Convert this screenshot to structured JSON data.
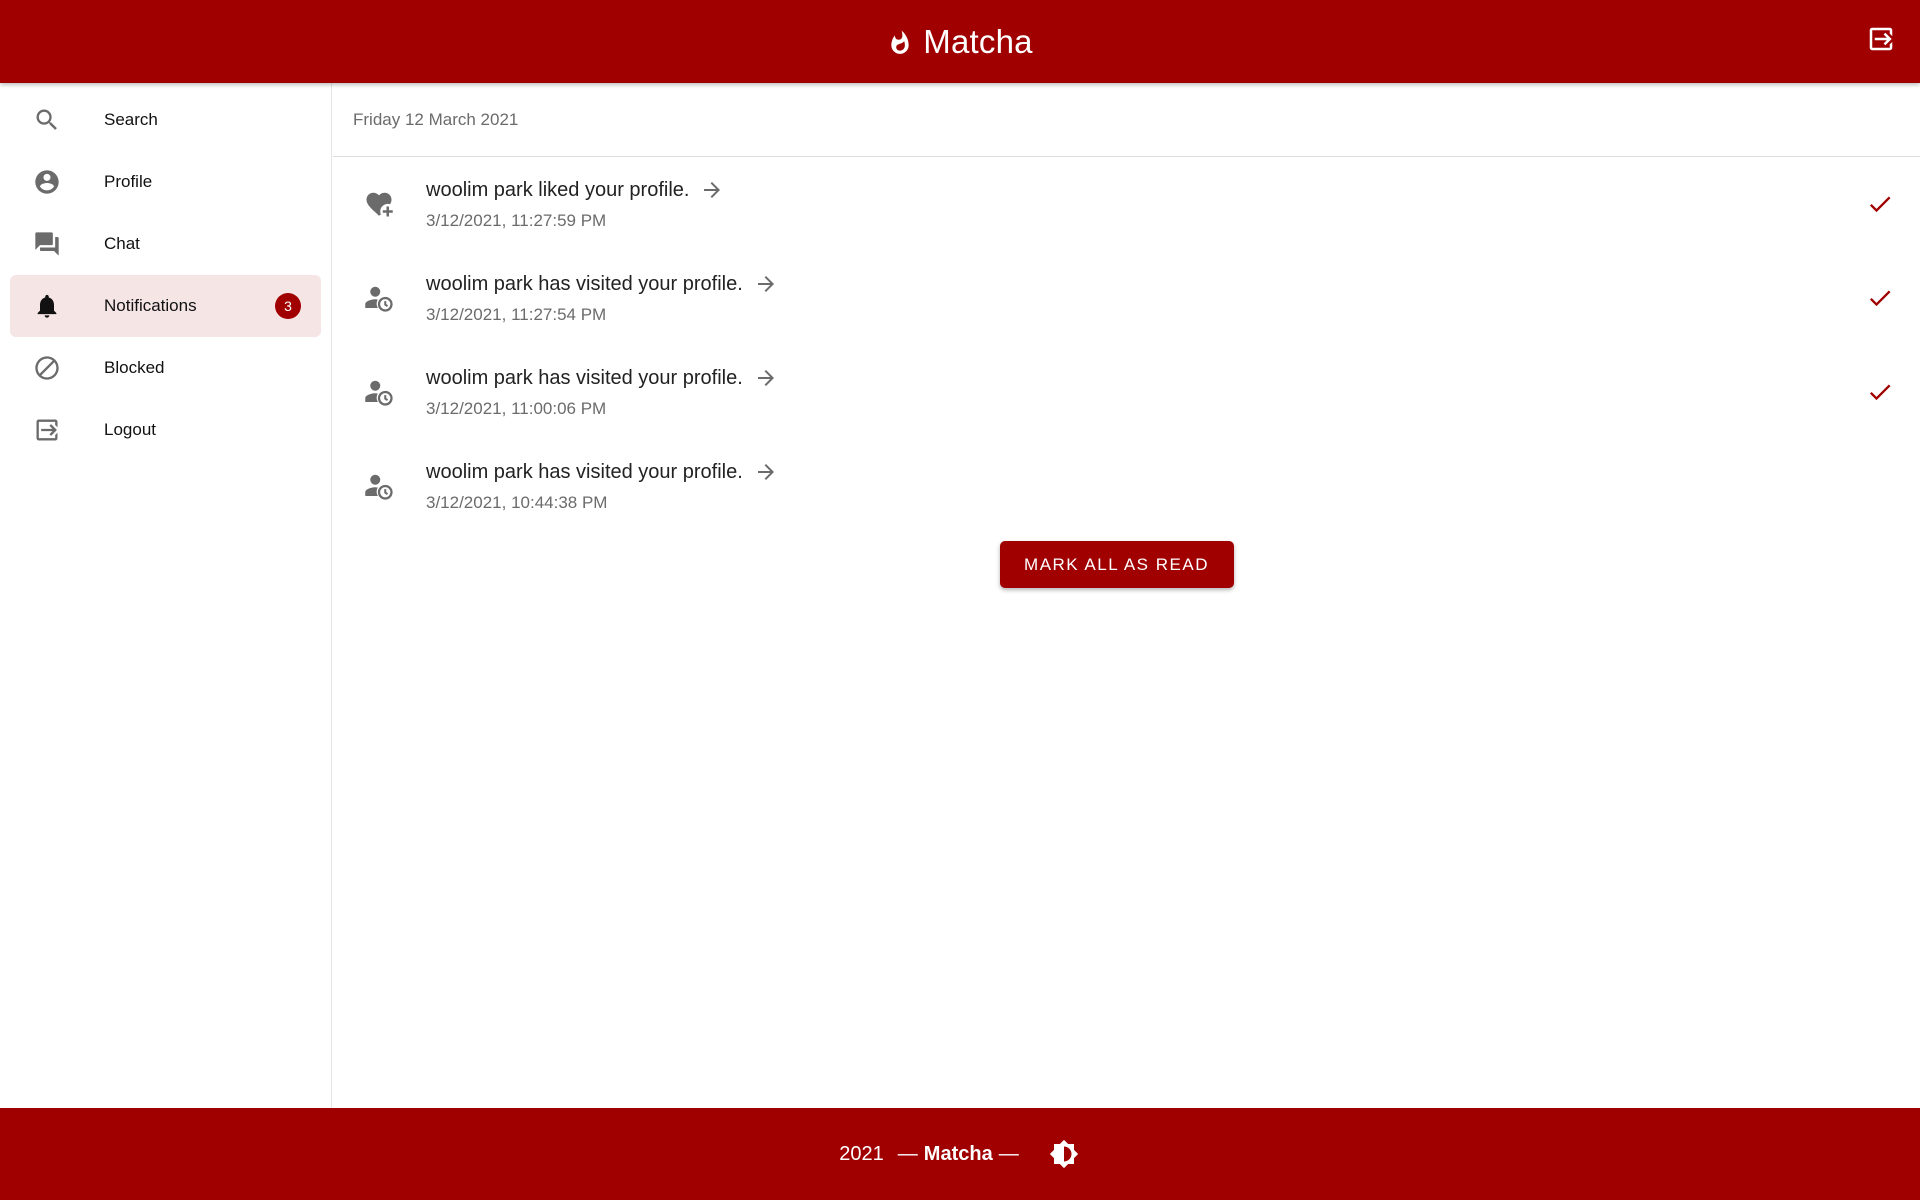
{
  "app": {
    "title": "Matcha",
    "brand_color": "#a00000"
  },
  "header": {
    "title": "Matcha",
    "icons": [
      "flame-icon",
      "logout-icon"
    ]
  },
  "sidebar": {
    "items": [
      {
        "label": "Search",
        "icon": "search-icon",
        "active": false
      },
      {
        "label": "Profile",
        "icon": "account-circle-icon",
        "active": false
      },
      {
        "label": "Chat",
        "icon": "chat-icon",
        "active": false
      },
      {
        "label": "Notifications",
        "icon": "bell-icon",
        "active": true,
        "badge": "3"
      },
      {
        "label": "Blocked",
        "icon": "block-icon",
        "active": false
      },
      {
        "label": "Logout",
        "icon": "logout-icon",
        "active": false
      }
    ]
  },
  "main": {
    "date_header": "Friday 12 March 2021",
    "notifications": [
      {
        "message": "woolim park liked your profile.",
        "time": "3/12/2021, 11:27:59 PM",
        "type_icon": "heart-plus-icon",
        "unread": true
      },
      {
        "message": "woolim park has visited your profile.",
        "time": "3/12/2021, 11:27:54 PM",
        "type_icon": "person-clock-icon",
        "unread": true
      },
      {
        "message": "woolim park has visited your profile.",
        "time": "3/12/2021, 11:00:06 PM",
        "type_icon": "person-clock-icon",
        "unread": true
      },
      {
        "message": "woolim park has visited your profile.",
        "time": "3/12/2021, 10:44:38 PM",
        "type_icon": "person-clock-icon",
        "unread": false
      }
    ],
    "mark_all_label": "MARK ALL AS READ"
  },
  "footer": {
    "year": "2021",
    "dash": "—",
    "brand": "Matcha",
    "theme_icon": "brightness-icon"
  }
}
